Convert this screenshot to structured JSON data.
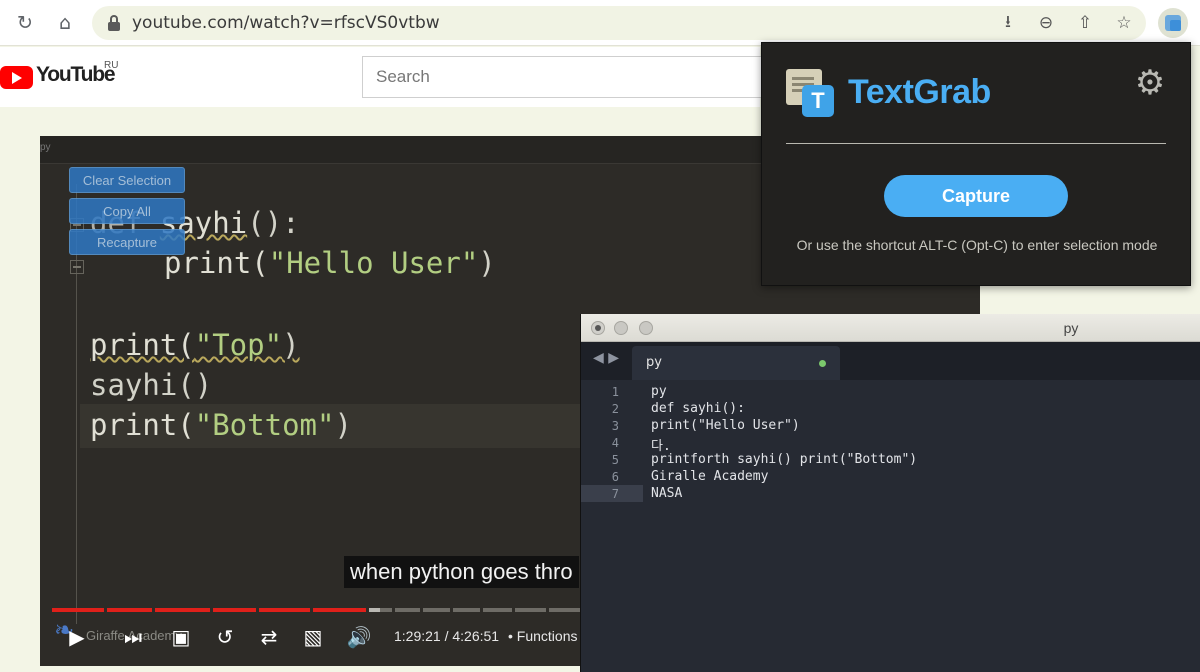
{
  "browser": {
    "url": "youtube.com/watch?v=rfscVS0vtbw",
    "icons": [
      "reload-icon",
      "home-icon",
      "lock-icon",
      "install-icon",
      "zoom-out-icon",
      "share-icon",
      "star-icon",
      "textgrab-extension-icon"
    ]
  },
  "youtube": {
    "logo_text": "YouTube",
    "region": "RU",
    "search_placeholder": "Search"
  },
  "video": {
    "tab_label": "py",
    "buttons": [
      "Clear Selection",
      "Copy All",
      "Recapture"
    ],
    "code": {
      "line1_kw": "def ",
      "line1_fn": "sayhi",
      "line1_rest": "():",
      "line2_fn": "print(",
      "line2_str": "\"Hello User\"",
      "line2_end": ")",
      "line3_fn": "print(",
      "line3_str": "\"Top\"",
      "line3_end": ")",
      "line4": "sayhi()",
      "line5_fn": "print(",
      "line5_str": "\"Bottom\"",
      "line5_end": ")"
    },
    "caption": "when python goes thro",
    "time": "1:29:21 / 4:26:51",
    "chapter": "• Functions",
    "channel": "Giraffe Academy",
    "progress_fraction": 0.338
  },
  "textgrab": {
    "title": "TextGrab",
    "capture_label": "Capture",
    "hint": "Or use the shortcut ALT-C (Opt-C) to enter selection mode",
    "accent": "#4aaef3"
  },
  "editor": {
    "window_title": "py",
    "tab_label": "py",
    "lines": [
      {
        "n": "1",
        "text": "py"
      },
      {
        "n": "2",
        "text": "def sayhi():"
      },
      {
        "n": "3",
        "text": "print(\"Hello User\")"
      },
      {
        "n": "4",
        "text": "다."
      },
      {
        "n": "5",
        "text": "printforth sayhi() print(\"Bottom\")"
      },
      {
        "n": "6",
        "text": "Giralle Academy"
      },
      {
        "n": "7",
        "text": "NASA"
      }
    ]
  }
}
